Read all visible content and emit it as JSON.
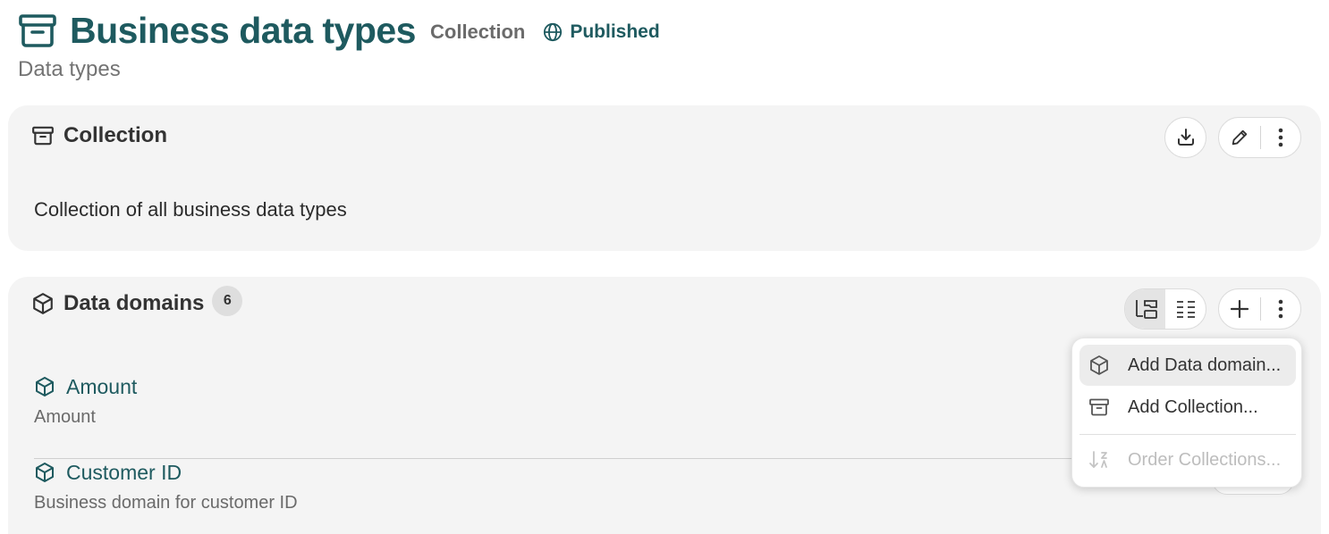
{
  "header": {
    "title": "Business data types",
    "type_label": "Collection",
    "status": "Published",
    "subtitle": "Data types"
  },
  "collection_card": {
    "title": "Collection",
    "description": "Collection of all business data types"
  },
  "domains_card": {
    "title": "Data domains",
    "count": "6",
    "items": [
      {
        "name": "Amount",
        "description": "Amount"
      },
      {
        "name": "Customer ID",
        "description": "Business domain for customer ID"
      }
    ]
  },
  "menu": {
    "items": [
      {
        "label": "Add Data domain...",
        "icon": "cube-icon",
        "state": "hovered"
      },
      {
        "label": "Add Collection...",
        "icon": "archive-icon",
        "state": "enabled"
      },
      {
        "label": "Order Collections...",
        "icon": "sort-icon",
        "state": "disabled"
      }
    ]
  },
  "colors": {
    "accent": "#1e5a5f",
    "card_bg": "#f4f4f4",
    "muted_text": "#6a6a6a"
  }
}
